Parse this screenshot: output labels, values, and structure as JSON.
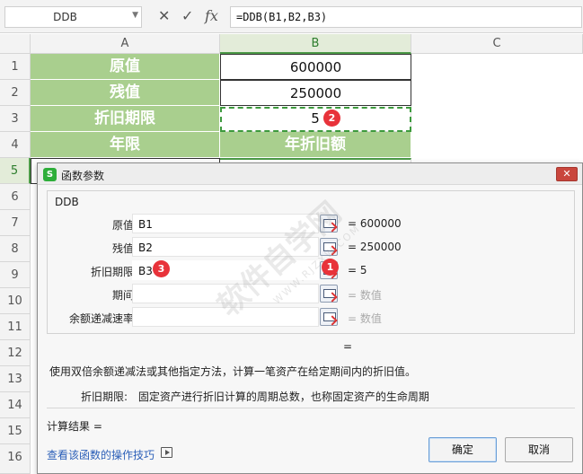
{
  "formula_bar": {
    "name_box": "DDB",
    "cancel_icon": "✕",
    "enter_icon": "✓",
    "fx_label": "fx",
    "formula": "=DDB(B1,B2,B3)"
  },
  "columns": [
    "A",
    "B",
    "C"
  ],
  "rows": [
    "1",
    "2",
    "3",
    "4",
    "5",
    "6",
    "7",
    "8",
    "9",
    "10",
    "11",
    "12",
    "13",
    "14",
    "15",
    "16"
  ],
  "cells": {
    "a1": "原值",
    "b1": "600000",
    "a2": "残值",
    "b2": "250000",
    "a3": "折旧期限",
    "b3": "5",
    "a4": "年限",
    "b4": "年折旧额"
  },
  "badges": {
    "cell_b3": "2",
    "arg_result": "1",
    "arg_input": "3"
  },
  "dialog": {
    "title": "函数参数",
    "logo": "S",
    "close": "✕",
    "function_name": "DDB",
    "args": [
      {
        "label": "原值",
        "value": "B1",
        "result": "= 600000"
      },
      {
        "label": "残值",
        "value": "B2",
        "result": "= 250000"
      },
      {
        "label": "折旧期限",
        "value": "B3",
        "result": "= 5"
      },
      {
        "label": "期间",
        "value": "",
        "result": "= 数值"
      },
      {
        "label": "余额递减速率",
        "value": "",
        "result": "= 数值"
      }
    ],
    "mid_result": "=",
    "description": "使用双倍余额递减法或其他指定方法，计算一笔资产在给定期间内的折旧值。",
    "param_name": "折旧期限:",
    "param_desc": "固定资产进行折旧计算的周期总数，也称固定资产的生命周期",
    "calc_result": "计算结果 =",
    "help_link": "查看该函数的操作技巧",
    "ok": "确定",
    "cancel": "取消"
  },
  "watermark": {
    "main": "软件自学网",
    "sub": "WWW.RJZXW.COM"
  }
}
